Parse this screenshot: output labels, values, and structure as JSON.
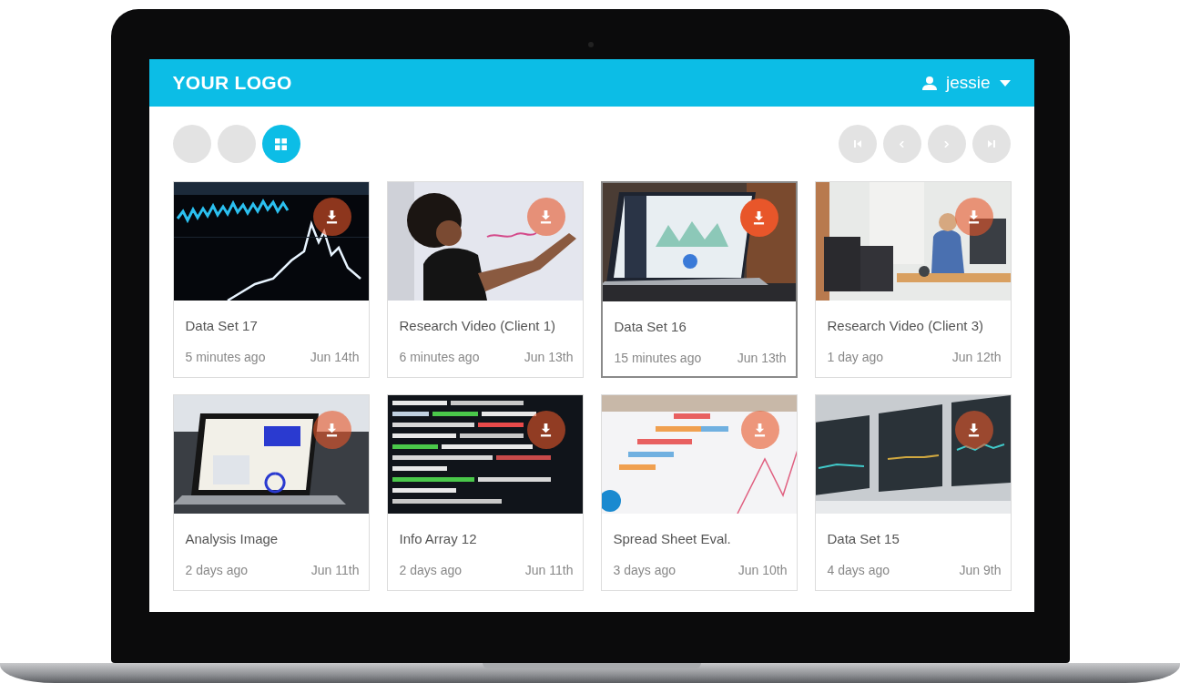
{
  "header": {
    "logo": "YOUR LOGO",
    "user": "jessie"
  },
  "view_buttons": [
    {
      "kind": "blank",
      "selected": false
    },
    {
      "kind": "blank",
      "selected": false
    },
    {
      "kind": "grid",
      "selected": true
    }
  ],
  "pager": [
    {
      "kind": "first"
    },
    {
      "kind": "prev"
    },
    {
      "kind": "next"
    },
    {
      "kind": "last"
    }
  ],
  "cards": [
    {
      "title": "Data Set 17",
      "age": "5 minutes ago",
      "date": "Jun 14th",
      "selected": false
    },
    {
      "title": "Research Video (Client 1)",
      "age": "6 minutes ago",
      "date": "Jun 13th",
      "selected": false
    },
    {
      "title": "Data Set 16",
      "age": "15 minutes ago",
      "date": "Jun 13th",
      "selected": true
    },
    {
      "title": "Research Video (Client 3)",
      "age": "1 day ago",
      "date": "Jun 12th",
      "selected": false
    },
    {
      "title": "Analysis Image",
      "age": "2 days ago",
      "date": "Jun 11th",
      "selected": false
    },
    {
      "title": "Info Array 12",
      "age": "2 days ago",
      "date": "Jun 11th",
      "selected": false
    },
    {
      "title": "Spread Sheet Eval.",
      "age": "3 days ago",
      "date": "Jun 10th",
      "selected": false
    },
    {
      "title": "Data Set 15",
      "age": "4 days ago",
      "date": "Jun 9th",
      "selected": false
    }
  ]
}
